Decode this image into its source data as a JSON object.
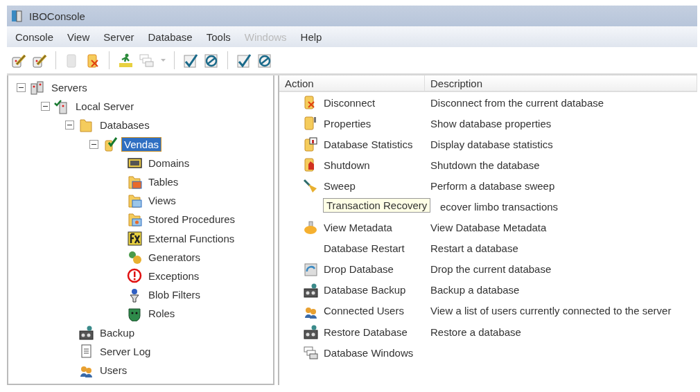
{
  "window": {
    "title": "IBOConsole"
  },
  "menu": [
    {
      "label": "Console",
      "disabled": false
    },
    {
      "label": "View",
      "disabled": false
    },
    {
      "label": "Server",
      "disabled": false
    },
    {
      "label": "Database",
      "disabled": false
    },
    {
      "label": "Tools",
      "disabled": false
    },
    {
      "label": "Windows",
      "disabled": true
    },
    {
      "label": "Help",
      "disabled": false
    }
  ],
  "toolbar": [
    [
      {
        "kind": "connect",
        "disabled": false
      },
      {
        "kind": "connect",
        "disabled": false
      }
    ],
    [
      {
        "kind": "register",
        "disabled": true
      },
      {
        "kind": "unregister",
        "disabled": false
      }
    ],
    [
      {
        "kind": "sql",
        "disabled": false
      },
      {
        "kind": "windows",
        "disabled": true
      }
    ],
    [
      {
        "kind": "commit",
        "disabled": false
      },
      {
        "kind": "rollback",
        "disabled": false
      }
    ],
    [
      {
        "kind": "commit",
        "disabled": false
      },
      {
        "kind": "rollback",
        "disabled": false
      }
    ]
  ],
  "tree": [
    {
      "label": "Servers",
      "kind": "servers",
      "expanded": true,
      "selected": false,
      "children": [
        {
          "label": "Local Server",
          "kind": "server",
          "expanded": true,
          "selected": false,
          "children": [
            {
              "label": "Databases",
              "kind": "folder",
              "expanded": true,
              "selected": false,
              "children": [
                {
                  "label": "Vendas",
                  "kind": "database",
                  "expanded": true,
                  "selected": true,
                  "children": [
                    {
                      "label": "Domains",
                      "kind": "domains",
                      "selected": false
                    },
                    {
                      "label": "Tables",
                      "kind": "tables",
                      "selected": false
                    },
                    {
                      "label": "Views",
                      "kind": "views",
                      "selected": false
                    },
                    {
                      "label": "Stored Procedures",
                      "kind": "procedures",
                      "selected": false
                    },
                    {
                      "label": "External Functions",
                      "kind": "functions",
                      "selected": false
                    },
                    {
                      "label": "Generators",
                      "kind": "generators",
                      "selected": false
                    },
                    {
                      "label": "Exceptions",
                      "kind": "exceptions",
                      "selected": false
                    },
                    {
                      "label": "Blob Filters",
                      "kind": "filters",
                      "selected": false
                    },
                    {
                      "label": "Roles",
                      "kind": "roles",
                      "selected": false
                    }
                  ]
                }
              ]
            },
            {
              "label": "Backup",
              "kind": "backup",
              "selected": false
            },
            {
              "label": "Server Log",
              "kind": "log",
              "selected": false
            },
            {
              "label": "Users",
              "kind": "users",
              "selected": false
            }
          ]
        }
      ]
    }
  ],
  "actions": {
    "columns": [
      "Action",
      "Description"
    ],
    "rows": [
      {
        "kind": "disconnect",
        "action": "Disconnect",
        "description": "Disconnect from the current database"
      },
      {
        "kind": "properties",
        "action": "Properties",
        "description": "Show database properties"
      },
      {
        "kind": "statistics",
        "action": "Database Statistics",
        "description": "Display database statistics"
      },
      {
        "kind": "shutdown",
        "action": "Shutdown",
        "description": "Shutdown the database"
      },
      {
        "kind": "sweep",
        "action": "Sweep",
        "description": "Perform a database sweep"
      },
      {
        "kind": "none",
        "tooltip": "Transaction Recovery",
        "description": "ecover limbo transactions"
      },
      {
        "kind": "metadata",
        "action": "View Metadata",
        "description": "View Database Metadata"
      },
      {
        "kind": "none",
        "action": "Database Restart",
        "description": "Restart a database"
      },
      {
        "kind": "drop",
        "action": "Drop Database",
        "description": "Drop the current database"
      },
      {
        "kind": "backup",
        "action": "Database Backup",
        "description": "Backup a database"
      },
      {
        "kind": "users",
        "action": "Connected Users",
        "description": "View a list of users currently connected to the server"
      },
      {
        "kind": "backup",
        "action": "Restore Database",
        "description": "Restore a database"
      },
      {
        "kind": "windows",
        "action": "Database Windows"
      }
    ]
  }
}
